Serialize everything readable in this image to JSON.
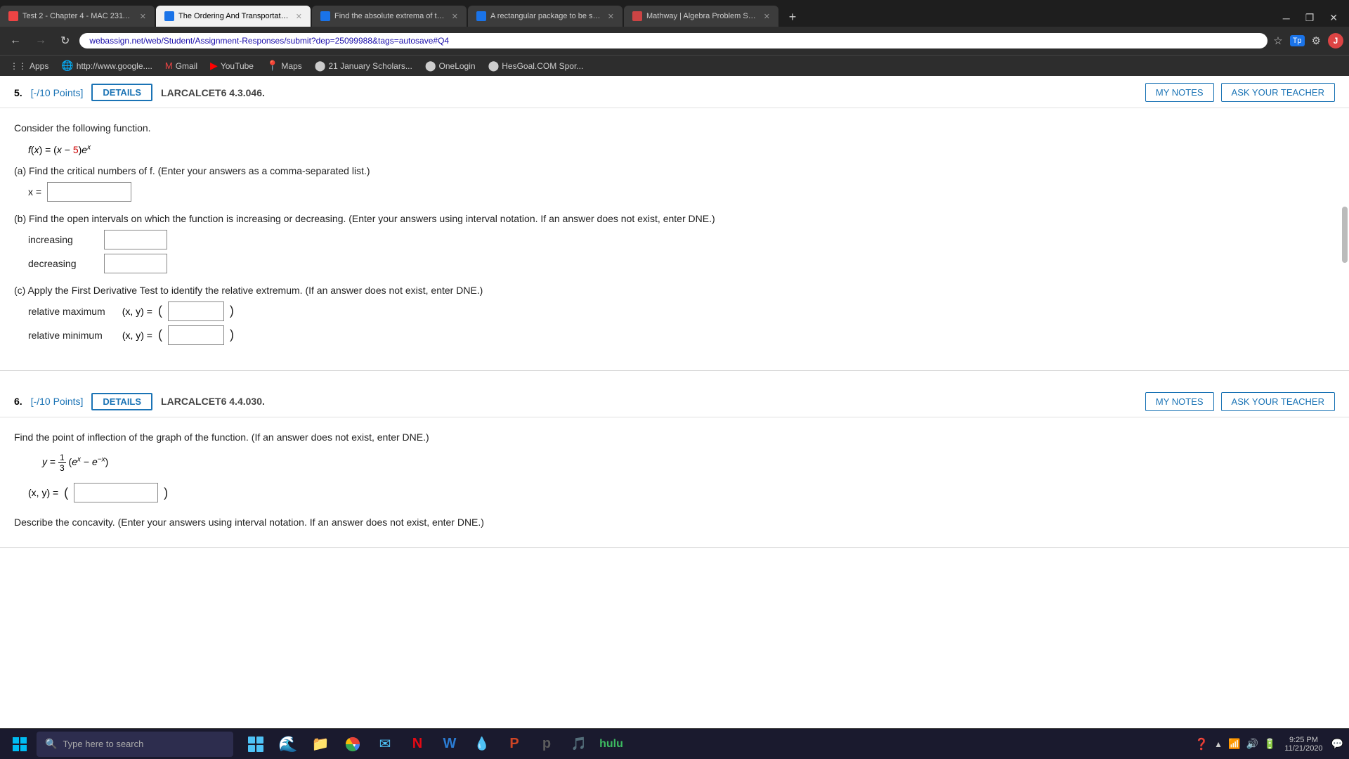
{
  "browser": {
    "tabs": [
      {
        "id": "tab1",
        "title": "Test 2 - Chapter 4 - MAC 2311, s...",
        "favicon_color": "#e44",
        "active": false
      },
      {
        "id": "tab2",
        "title": "The Ordering And Transportation...",
        "favicon_color": "#1a73e8",
        "active": true
      },
      {
        "id": "tab3",
        "title": "Find the absolute extrema of the...",
        "favicon_color": "#1a73e8",
        "active": false
      },
      {
        "id": "tab4",
        "title": "A rectangular package to be sen...",
        "favicon_color": "#1a73e8",
        "active": false
      },
      {
        "id": "tab5",
        "title": "Mathway | Algebra Problem Solv...",
        "favicon_color": "#c44",
        "active": false
      }
    ],
    "address": "webassign.net/web/Student/Assignment-Responses/submit?dep=25099988&tags=autosave#Q4",
    "bookmarks": [
      {
        "label": "Apps",
        "favicon_color": "#aaa"
      },
      {
        "label": "http://www.google....",
        "favicon_color": "#4285f4"
      },
      {
        "label": "Gmail",
        "favicon_color": "#e44"
      },
      {
        "label": "YouTube",
        "favicon_color": "#f00"
      },
      {
        "label": "Maps",
        "favicon_color": "#4285f4"
      },
      {
        "label": "21 January Scholars...",
        "favicon_color": "#888"
      },
      {
        "label": "OneLogin",
        "favicon_color": "#555"
      },
      {
        "label": "HesGoal.COM Spor...",
        "favicon_color": "#555"
      }
    ]
  },
  "question5": {
    "number": "5.",
    "points": "[-/10 Points]",
    "details_btn": "DETAILS",
    "ref": "LARCALCET6 4.3.046.",
    "my_notes_btn": "MY NOTES",
    "ask_teacher_btn": "ASK YOUR TEACHER",
    "instruction": "Consider the following function.",
    "function_display": "f(x) = (x − 5)eˣ",
    "part_a_label": "(a) Find the critical numbers of f. (Enter your answers as a comma-separated list.)",
    "part_a_var": "x =",
    "part_b_label": "(b) Find the open intervals on which the function is increasing or decreasing. (Enter your answers using interval notation. If an answer does not exist, enter DNE.)",
    "increasing_label": "increasing",
    "decreasing_label": "decreasing",
    "part_c_label": "(c) Apply the First Derivative Test to identify the relative extremum. (If an answer does not exist, enter DNE.)",
    "rel_max_label": "relative maximum",
    "rel_max_xy": "(x, y) =",
    "rel_min_label": "relative minimum",
    "rel_min_xy": "(x, y) ="
  },
  "question6": {
    "number": "6.",
    "points": "[-/10 Points]",
    "details_btn": "DETAILS",
    "ref": "LARCALCET6 4.4.030.",
    "my_notes_btn": "MY NOTES",
    "ask_teacher_btn": "ASK YOUR TEACHER",
    "instruction": "Find the point of inflection of the graph of the function. (If an answer does not exist, enter DNE.)",
    "function_display": "y = ¹⁄₃(eˣ − e⁻ˣ)",
    "xy_label": "(x, y) =",
    "concavity_label": "Describe the concavity. (Enter your answers using interval notation. If an answer does not exist, enter DNE.)"
  },
  "taskbar": {
    "search_placeholder": "Type here to search",
    "time": "9:25 PM",
    "date": "11/21/2020"
  }
}
